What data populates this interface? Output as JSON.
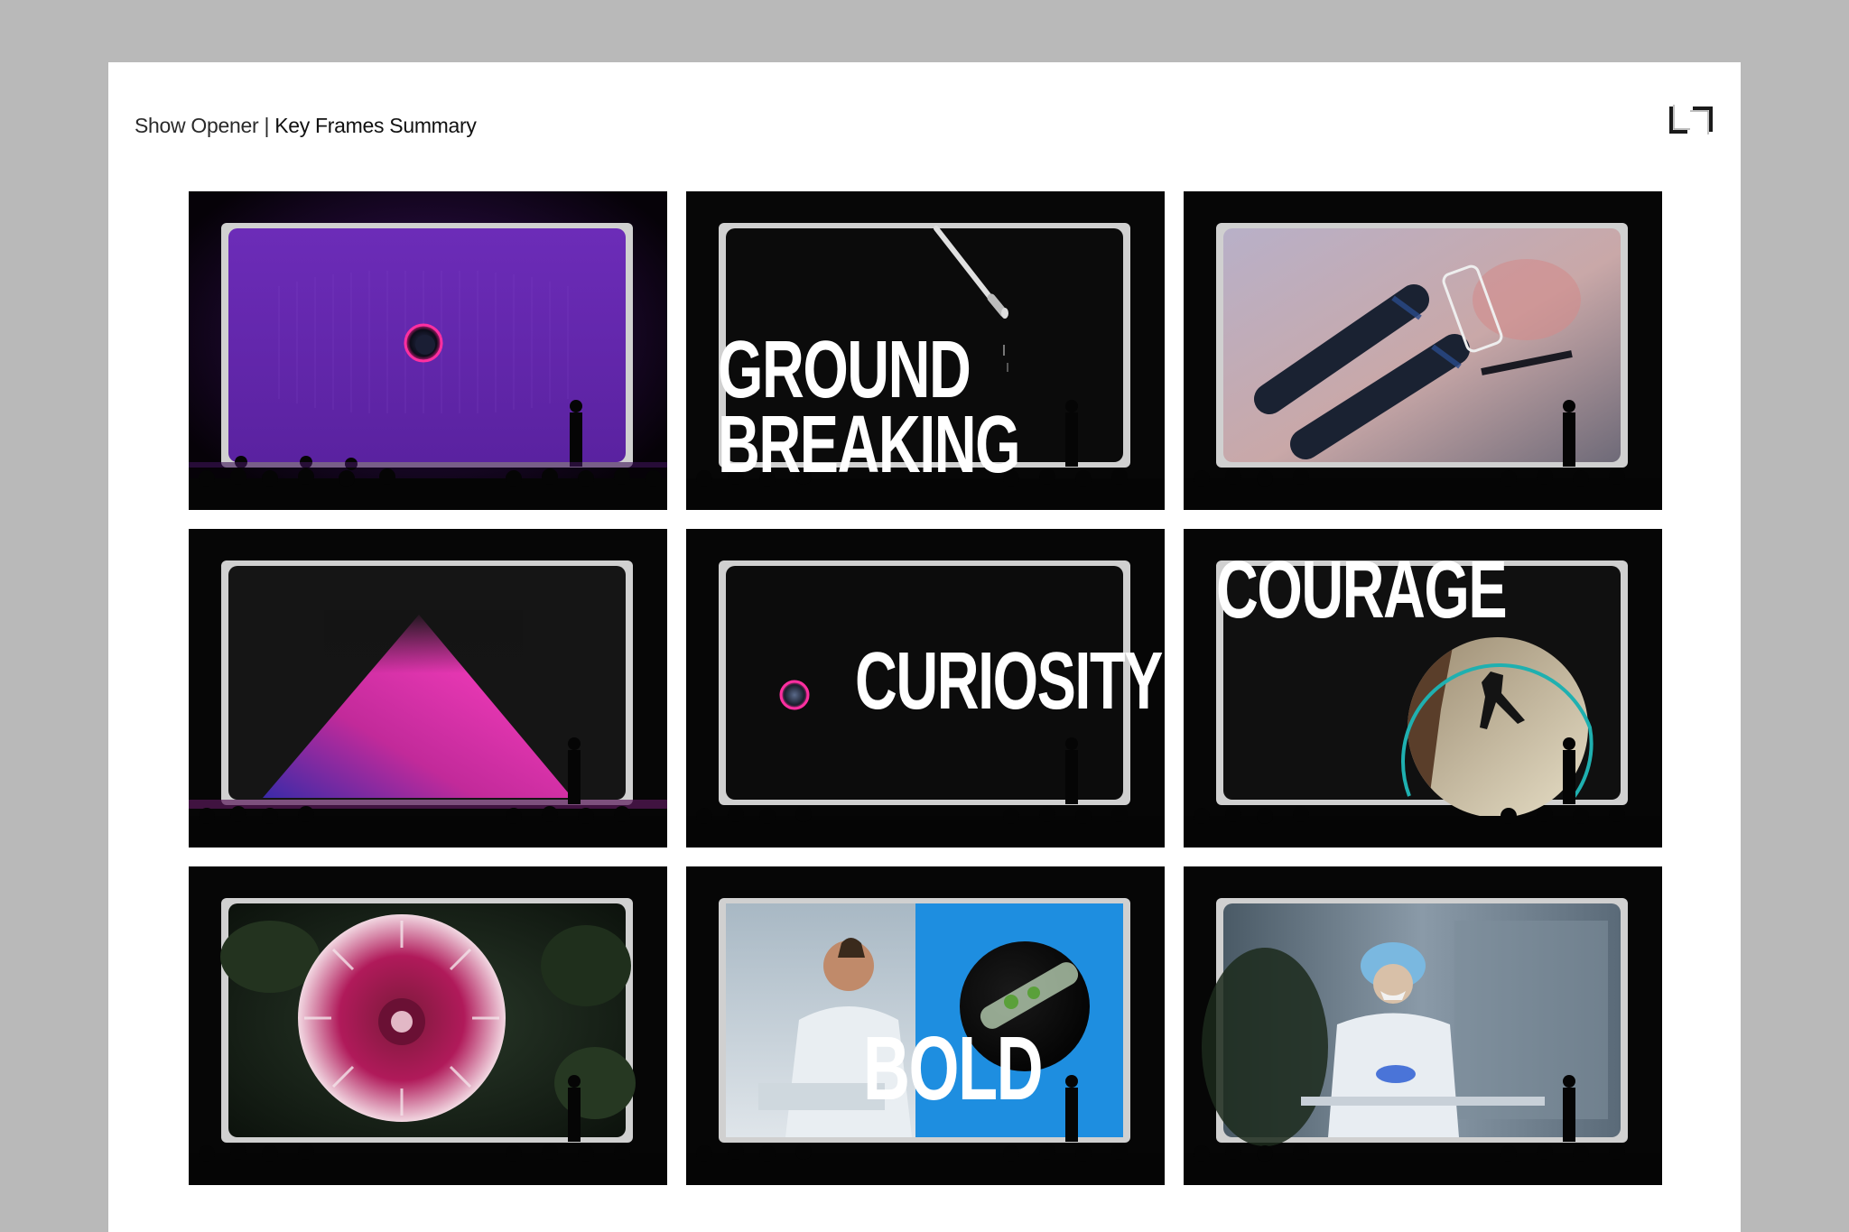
{
  "header": {
    "title_prefix": "Show Opener",
    "separator": "|",
    "title_main": "Key Frames Summary",
    "logo_text": "L7"
  },
  "frames": [
    {
      "name": "frame-purple-orb",
      "word": ""
    },
    {
      "name": "frame-ground-breaking",
      "word_lines": [
        "GROUND",
        "BREAKING"
      ]
    },
    {
      "name": "frame-microscope",
      "word": ""
    },
    {
      "name": "frame-pink-pyramid",
      "word": ""
    },
    {
      "name": "frame-curiosity",
      "word": "CURIOSITY"
    },
    {
      "name": "frame-courage",
      "word": "COURAGE"
    },
    {
      "name": "frame-dahlia",
      "word": ""
    },
    {
      "name": "frame-bold",
      "word": "BOLD"
    },
    {
      "name": "frame-lab-worker",
      "word": ""
    }
  ],
  "colors": {
    "page_bg": "#b9b9b9",
    "sheet_bg": "#ffffff",
    "stage_bg": "#050505",
    "screen_border": "#cfcfcf",
    "purple": "#6b2bb0",
    "magenta": "#e4258f",
    "teal": "#1bb3b3",
    "blue": "#1e8ee0"
  }
}
